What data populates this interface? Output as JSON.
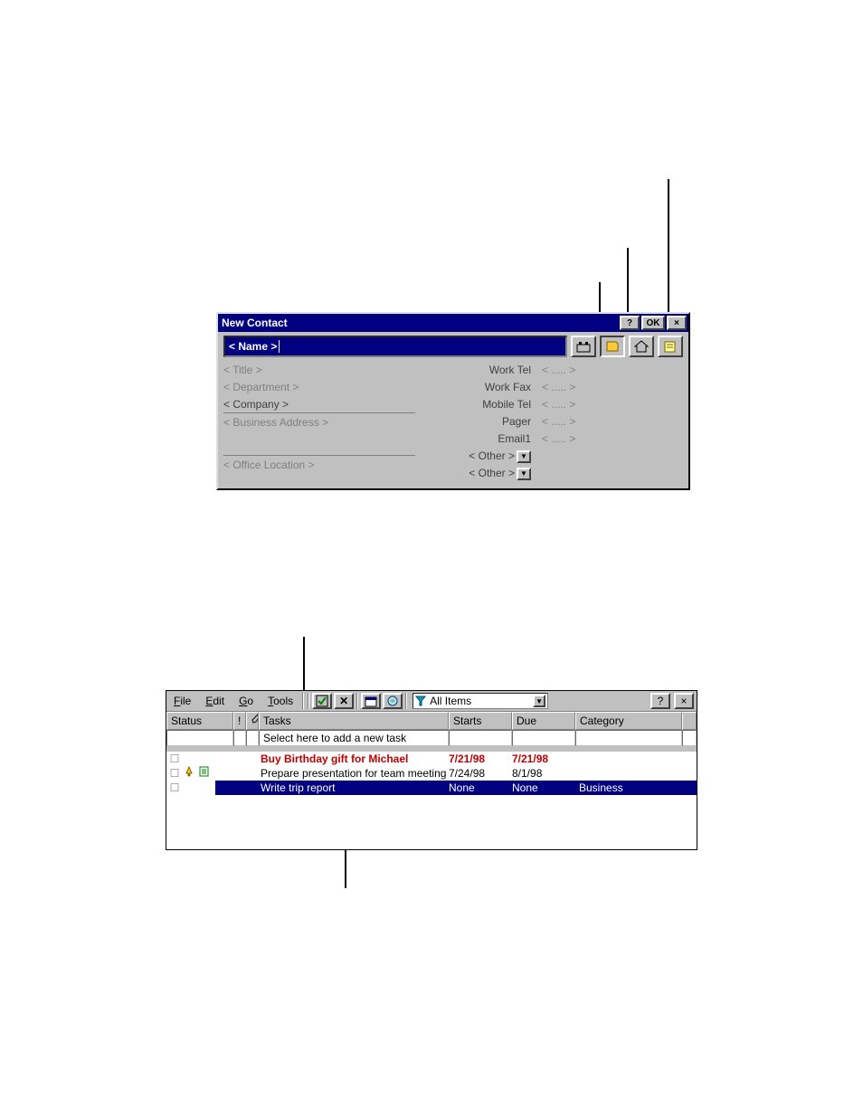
{
  "contact": {
    "title": "New Contact",
    "help_btn": "?",
    "ok_btn": "OK",
    "close_btn": "×",
    "name_placeholder": "< Name >",
    "tabs": {
      "rolodex_icon": "rolodex-icon",
      "notes_icon": "notes-icon",
      "home_icon": "home-icon",
      "book_icon": "book-icon"
    },
    "left_fields": {
      "title": "< Title >",
      "department": "< Department >",
      "company": "< Company >",
      "business_address": "< Business Address >",
      "office_location": "< Office Location >"
    },
    "right_labels": {
      "work_tel": "Work Tel",
      "work_fax": "Work Fax",
      "mobile_tel": "Mobile Tel",
      "pager": "Pager",
      "email1": "Email1",
      "other1": "< Other >",
      "other2": "< Other >"
    },
    "value_placeholder": "< ..... >"
  },
  "tasks": {
    "menus": {
      "file": "File",
      "edit": "Edit",
      "go": "Go",
      "tools": "Tools"
    },
    "filter_label": "All Items",
    "help_btn": "?",
    "close_btn": "×",
    "columns": {
      "status": "Status",
      "priority": "!",
      "note": "",
      "tasks": "Tasks",
      "starts": "Starts",
      "due": "Due",
      "category": "Category"
    },
    "new_task_prompt": "Select here to add a new task",
    "rows": [
      {
        "checked": false,
        "bell": false,
        "note": false,
        "task": "Buy Birthday gift for Michael",
        "starts": "7/21/98",
        "due": "7/21/98",
        "category": "",
        "style": "overdue"
      },
      {
        "checked": false,
        "bell": true,
        "note": true,
        "task": "Prepare presentation for team meeting",
        "starts": "7/24/98",
        "due": "8/1/98",
        "category": "",
        "style": ""
      },
      {
        "checked": false,
        "bell": false,
        "note": false,
        "task": "Write trip report",
        "starts": "None",
        "due": "None",
        "category": "Business",
        "style": "selected"
      }
    ]
  }
}
